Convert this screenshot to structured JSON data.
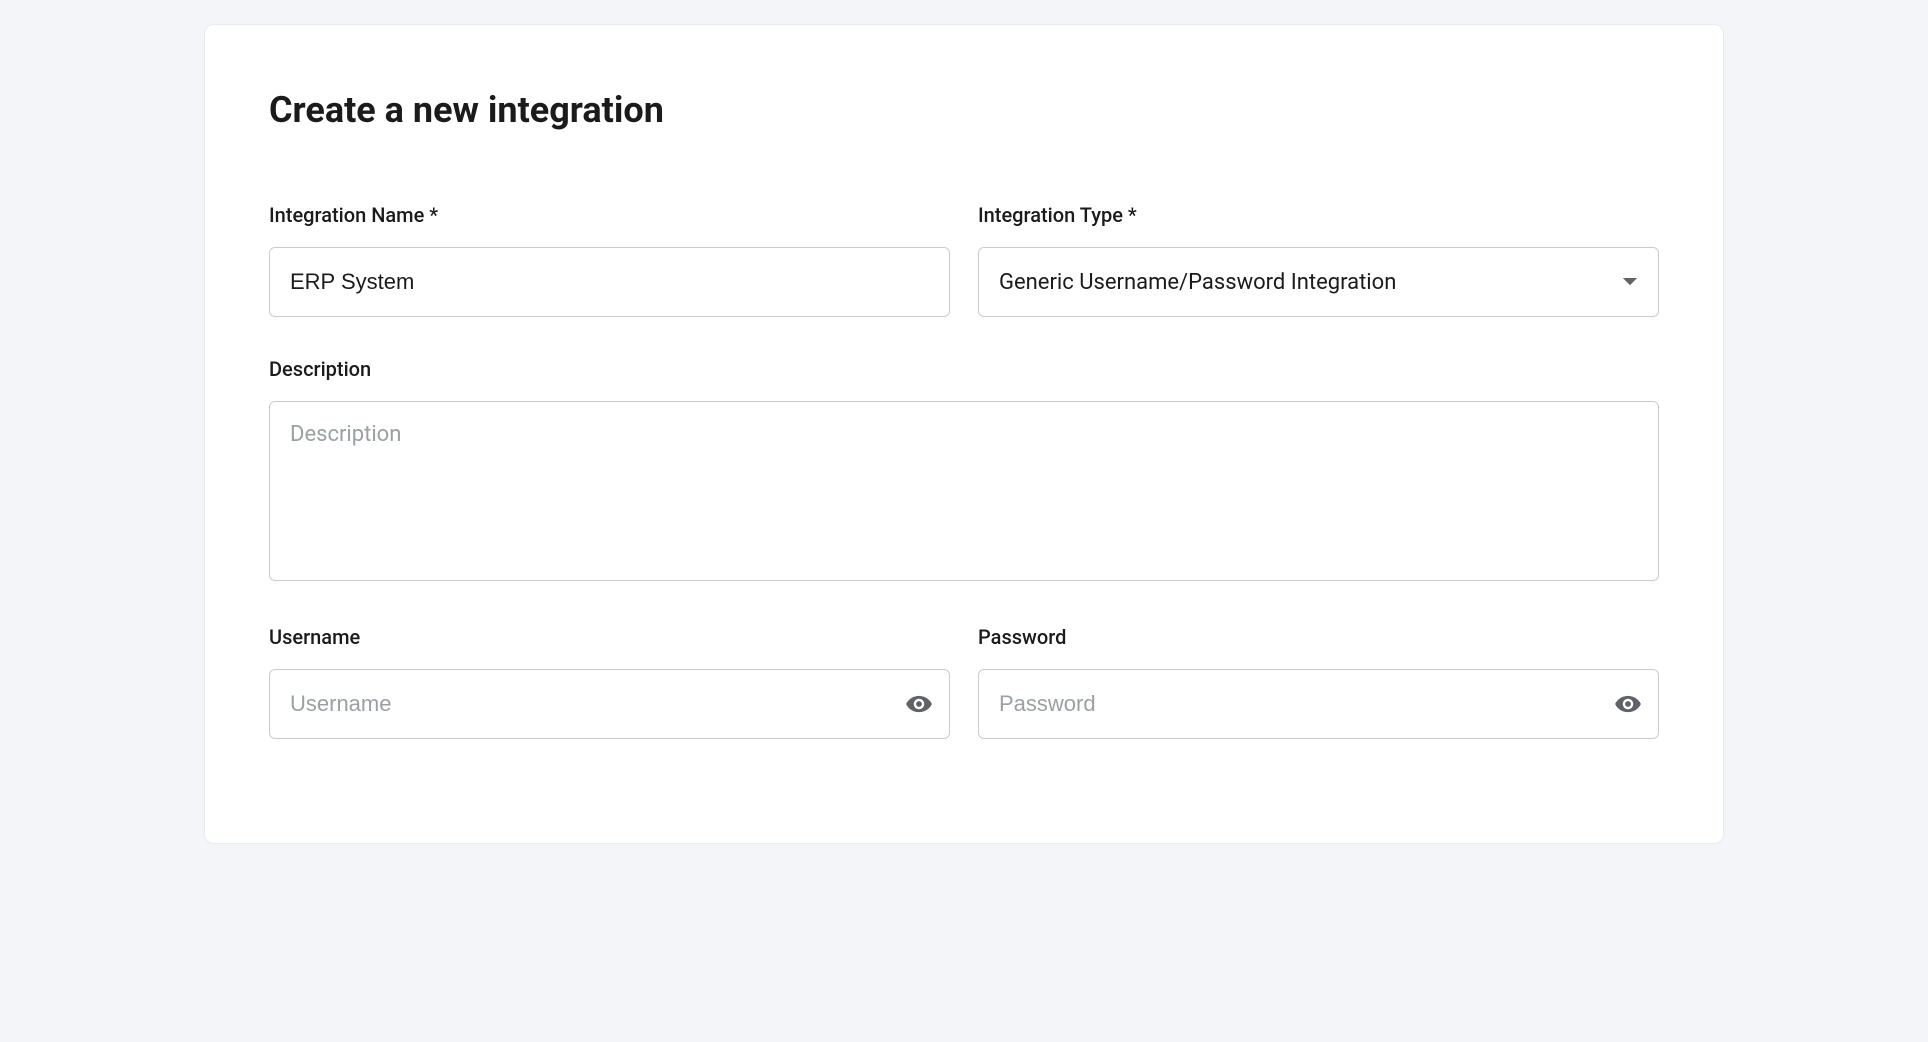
{
  "page": {
    "title": "Create a new integration"
  },
  "fields": {
    "integration_name": {
      "label": "Integration Name *",
      "value": "ERP System"
    },
    "integration_type": {
      "label": "Integration Type *",
      "selected": "Generic Username/Password Integration"
    },
    "description": {
      "label": "Description",
      "placeholder": "Description",
      "value": ""
    },
    "username": {
      "label": "Username",
      "placeholder": "Username",
      "value": ""
    },
    "password": {
      "label": "Password",
      "placeholder": "Password",
      "value": ""
    }
  }
}
